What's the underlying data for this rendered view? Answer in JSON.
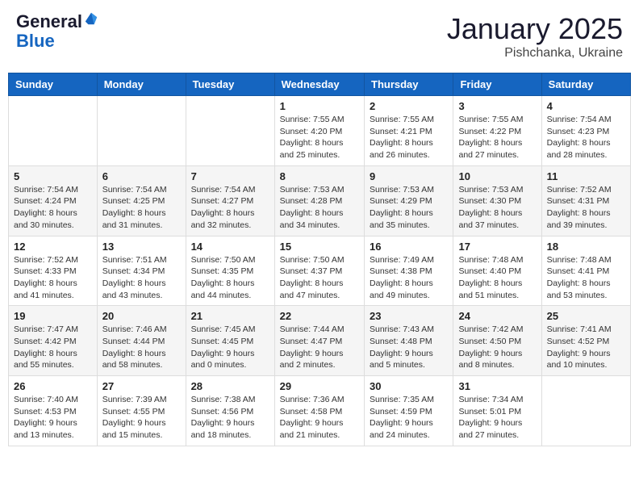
{
  "header": {
    "logo_general": "General",
    "logo_blue": "Blue",
    "month_title": "January 2025",
    "location": "Pishchanka, Ukraine"
  },
  "days_of_week": [
    "Sunday",
    "Monday",
    "Tuesday",
    "Wednesday",
    "Thursday",
    "Friday",
    "Saturday"
  ],
  "weeks": [
    [
      {
        "day": "",
        "info": ""
      },
      {
        "day": "",
        "info": ""
      },
      {
        "day": "",
        "info": ""
      },
      {
        "day": "1",
        "info": "Sunrise: 7:55 AM\nSunset: 4:20 PM\nDaylight: 8 hours\nand 25 minutes."
      },
      {
        "day": "2",
        "info": "Sunrise: 7:55 AM\nSunset: 4:21 PM\nDaylight: 8 hours\nand 26 minutes."
      },
      {
        "day": "3",
        "info": "Sunrise: 7:55 AM\nSunset: 4:22 PM\nDaylight: 8 hours\nand 27 minutes."
      },
      {
        "day": "4",
        "info": "Sunrise: 7:54 AM\nSunset: 4:23 PM\nDaylight: 8 hours\nand 28 minutes."
      }
    ],
    [
      {
        "day": "5",
        "info": "Sunrise: 7:54 AM\nSunset: 4:24 PM\nDaylight: 8 hours\nand 30 minutes."
      },
      {
        "day": "6",
        "info": "Sunrise: 7:54 AM\nSunset: 4:25 PM\nDaylight: 8 hours\nand 31 minutes."
      },
      {
        "day": "7",
        "info": "Sunrise: 7:54 AM\nSunset: 4:27 PM\nDaylight: 8 hours\nand 32 minutes."
      },
      {
        "day": "8",
        "info": "Sunrise: 7:53 AM\nSunset: 4:28 PM\nDaylight: 8 hours\nand 34 minutes."
      },
      {
        "day": "9",
        "info": "Sunrise: 7:53 AM\nSunset: 4:29 PM\nDaylight: 8 hours\nand 35 minutes."
      },
      {
        "day": "10",
        "info": "Sunrise: 7:53 AM\nSunset: 4:30 PM\nDaylight: 8 hours\nand 37 minutes."
      },
      {
        "day": "11",
        "info": "Sunrise: 7:52 AM\nSunset: 4:31 PM\nDaylight: 8 hours\nand 39 minutes."
      }
    ],
    [
      {
        "day": "12",
        "info": "Sunrise: 7:52 AM\nSunset: 4:33 PM\nDaylight: 8 hours\nand 41 minutes."
      },
      {
        "day": "13",
        "info": "Sunrise: 7:51 AM\nSunset: 4:34 PM\nDaylight: 8 hours\nand 43 minutes."
      },
      {
        "day": "14",
        "info": "Sunrise: 7:50 AM\nSunset: 4:35 PM\nDaylight: 8 hours\nand 44 minutes."
      },
      {
        "day": "15",
        "info": "Sunrise: 7:50 AM\nSunset: 4:37 PM\nDaylight: 8 hours\nand 47 minutes."
      },
      {
        "day": "16",
        "info": "Sunrise: 7:49 AM\nSunset: 4:38 PM\nDaylight: 8 hours\nand 49 minutes."
      },
      {
        "day": "17",
        "info": "Sunrise: 7:48 AM\nSunset: 4:40 PM\nDaylight: 8 hours\nand 51 minutes."
      },
      {
        "day": "18",
        "info": "Sunrise: 7:48 AM\nSunset: 4:41 PM\nDaylight: 8 hours\nand 53 minutes."
      }
    ],
    [
      {
        "day": "19",
        "info": "Sunrise: 7:47 AM\nSunset: 4:42 PM\nDaylight: 8 hours\nand 55 minutes."
      },
      {
        "day": "20",
        "info": "Sunrise: 7:46 AM\nSunset: 4:44 PM\nDaylight: 8 hours\nand 58 minutes."
      },
      {
        "day": "21",
        "info": "Sunrise: 7:45 AM\nSunset: 4:45 PM\nDaylight: 9 hours\nand 0 minutes."
      },
      {
        "day": "22",
        "info": "Sunrise: 7:44 AM\nSunset: 4:47 PM\nDaylight: 9 hours\nand 2 minutes."
      },
      {
        "day": "23",
        "info": "Sunrise: 7:43 AM\nSunset: 4:48 PM\nDaylight: 9 hours\nand 5 minutes."
      },
      {
        "day": "24",
        "info": "Sunrise: 7:42 AM\nSunset: 4:50 PM\nDaylight: 9 hours\nand 8 minutes."
      },
      {
        "day": "25",
        "info": "Sunrise: 7:41 AM\nSunset: 4:52 PM\nDaylight: 9 hours\nand 10 minutes."
      }
    ],
    [
      {
        "day": "26",
        "info": "Sunrise: 7:40 AM\nSunset: 4:53 PM\nDaylight: 9 hours\nand 13 minutes."
      },
      {
        "day": "27",
        "info": "Sunrise: 7:39 AM\nSunset: 4:55 PM\nDaylight: 9 hours\nand 15 minutes."
      },
      {
        "day": "28",
        "info": "Sunrise: 7:38 AM\nSunset: 4:56 PM\nDaylight: 9 hours\nand 18 minutes."
      },
      {
        "day": "29",
        "info": "Sunrise: 7:36 AM\nSunset: 4:58 PM\nDaylight: 9 hours\nand 21 minutes."
      },
      {
        "day": "30",
        "info": "Sunrise: 7:35 AM\nSunset: 4:59 PM\nDaylight: 9 hours\nand 24 minutes."
      },
      {
        "day": "31",
        "info": "Sunrise: 7:34 AM\nSunset: 5:01 PM\nDaylight: 9 hours\nand 27 minutes."
      },
      {
        "day": "",
        "info": ""
      }
    ]
  ]
}
